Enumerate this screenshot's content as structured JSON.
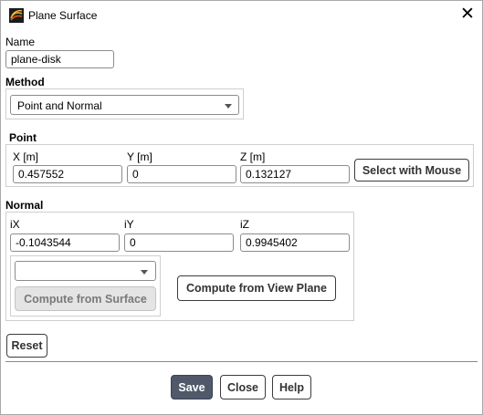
{
  "window": {
    "title": "Plane Surface",
    "icon": "fluent-app-icon",
    "close_glyph": "✕",
    "accent": "#50596a"
  },
  "name": {
    "label": "Name",
    "value": "plane-disk"
  },
  "method": {
    "label": "Method",
    "selected": "Point and Normal"
  },
  "point": {
    "label": "Point",
    "x_label": "X [m]",
    "y_label": "Y [m]",
    "z_label": "Z [m]",
    "x_value": "0.457552",
    "y_value": "0",
    "z_value": "0.132127",
    "select_mouse_label": "Select with Mouse"
  },
  "normal": {
    "label": "Normal",
    "ix_label": "iX",
    "iy_label": "iY",
    "iz_label": "iZ",
    "ix_value": "-0.1043544",
    "iy_value": "0",
    "iz_value": "0.9945402",
    "surface_select": "",
    "compute_surface_label": "Compute from Surface",
    "compute_view_label": "Compute from View Plane"
  },
  "actions": {
    "reset_label": "Reset",
    "save_label": "Save",
    "close_label": "Close",
    "help_label": "Help"
  }
}
